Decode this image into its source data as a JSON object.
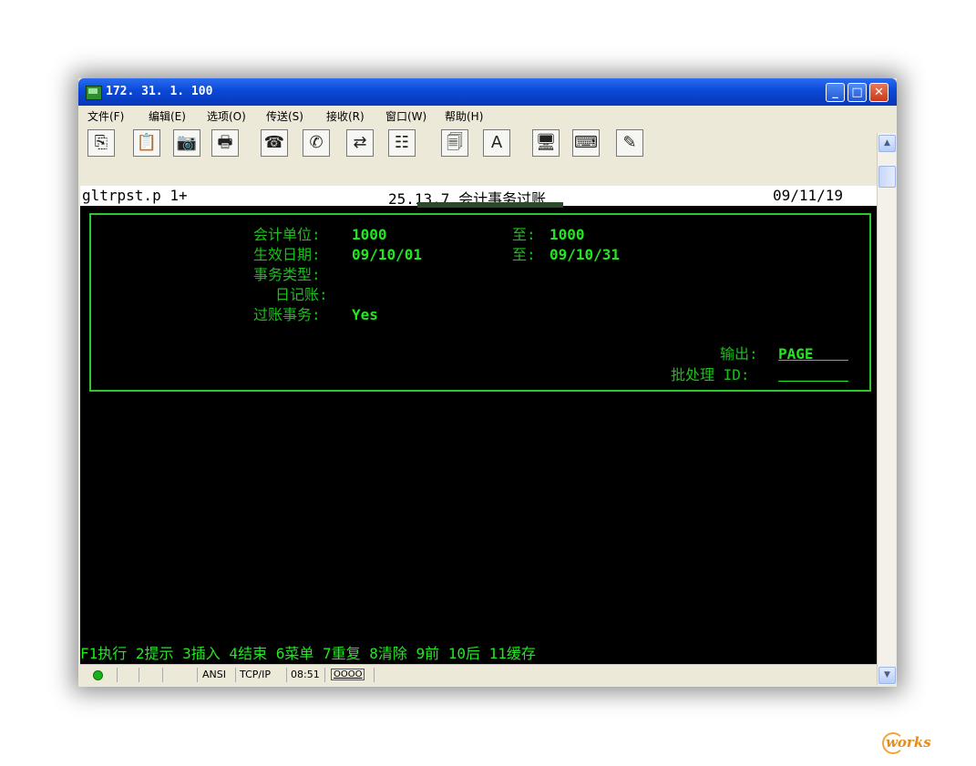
{
  "window": {
    "title": "172. 31. 1. 100",
    "min_label": "_",
    "max_label": "□",
    "close_label": "✕"
  },
  "menu": [
    "文件(F)",
    "编辑(E)",
    "选项(O)",
    "传送(S)",
    "接收(R)",
    "窗口(W)",
    "帮助(H)"
  ],
  "toolbar": {
    "tools": [
      {
        "name": "copy-icon",
        "glyph": "⎘"
      },
      {
        "name": "paste-icon",
        "glyph": "📋"
      },
      {
        "name": "camera-icon",
        "glyph": "📷"
      },
      {
        "name": "print-icon",
        "glyph": "🖶"
      },
      {
        "name": "phone-icon",
        "glyph": "☎"
      },
      {
        "name": "hangup-icon",
        "glyph": "✆"
      },
      {
        "name": "transfer-icon",
        "glyph": "⇄"
      },
      {
        "name": "layout-icon",
        "glyph": "☷"
      },
      {
        "name": "documents-icon",
        "glyph": "🗐"
      },
      {
        "name": "font-icon",
        "glyph": "A"
      },
      {
        "name": "monitor-icon",
        "glyph": "🖥"
      },
      {
        "name": "keyboard-icon",
        "glyph": "⌨"
      },
      {
        "name": "edit-icon",
        "glyph": "✎"
      }
    ]
  },
  "terminal": {
    "program": "gltrpst.p 1+",
    "title": "25.13.7 会计事务过账",
    "date": "09/11/19",
    "fields": {
      "entity_label": "会计单位:",
      "entity_from": "1000",
      "entity_to_label": "至:",
      "entity_to": "1000",
      "date_label": "生效日期:",
      "date_from": "09/10/01",
      "date_to_label": "至:",
      "date_to": "09/10/31",
      "type_label": "事务类型:",
      "journal_label": "日记账:",
      "post_label": "过账事务:",
      "post_value": "Yes",
      "output_label": "输出:",
      "output_value": "PAGE    ",
      "batch_label": "批处理 ID:",
      "batch_value": "        "
    },
    "function_keys": "F1执行 2提示 3插入 4结束 6菜单 7重复 8清除 9前 10后 11缓存"
  },
  "status": {
    "ansi": "ANSI",
    "protocol": "TCP/IP",
    "time": "08:51",
    "indicator": "OOOO"
  },
  "watermark": "works"
}
